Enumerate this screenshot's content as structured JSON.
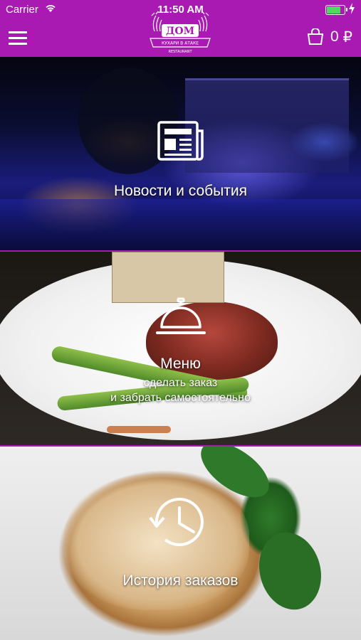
{
  "status_bar": {
    "carrier": "Carrier",
    "time": "11:50 AM",
    "battery_level": 0.85
  },
  "header": {
    "cart_count": "0",
    "cart_currency": "₽"
  },
  "tiles": [
    {
      "title": "Новости и события",
      "icon": "newspaper-icon"
    },
    {
      "title": "Меню",
      "subtitle_1": "сделать заказ",
      "subtitle_2": "и забрать самостоятельно",
      "icon": "service-bell-icon"
    },
    {
      "title": "История заказов",
      "icon": "history-clock-icon"
    }
  ],
  "colors": {
    "brand": "#a91ab2",
    "text": "#ffffff",
    "battery": "#4cd964"
  }
}
